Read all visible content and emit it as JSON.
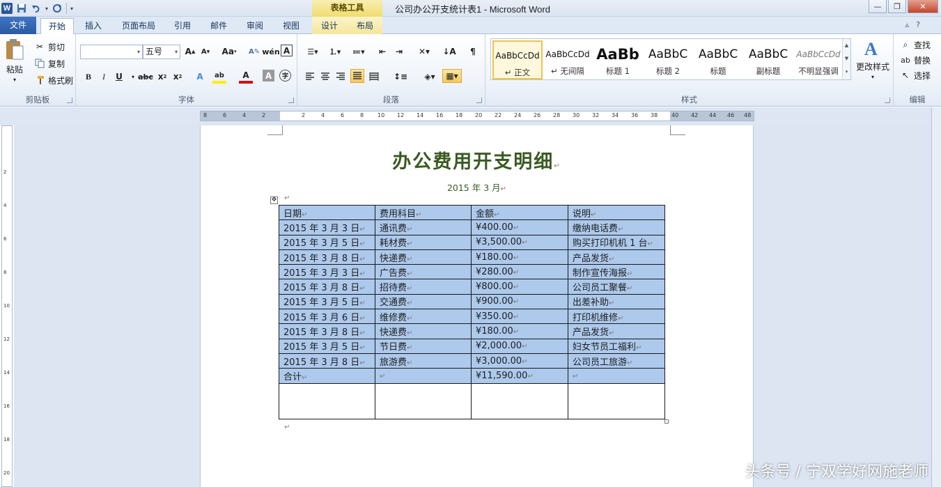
{
  "window": {
    "title": "公司办公开支统计表1 - Microsoft Word",
    "context_tools": "表格工具"
  },
  "qat": {
    "icons": [
      "word-logo-icon",
      "save-icon",
      "undo-icon",
      "redo-icon",
      "customize-qat-icon"
    ]
  },
  "tabs": {
    "file": "文件",
    "items": [
      "开始",
      "插入",
      "页面布局",
      "引用",
      "邮件",
      "审阅",
      "视图",
      "设计",
      "布局"
    ],
    "active_index": 0
  },
  "ribbon": {
    "clipboard": {
      "paste": "粘贴",
      "cut": "剪切",
      "copy": "复制",
      "format_painter": "格式刷",
      "label": "剪贴板"
    },
    "font": {
      "font_name": "",
      "font_size": "五号",
      "label": "字体",
      "change_case": "Aa"
    },
    "paragraph": {
      "label": "段落"
    },
    "styles": {
      "label": "样式",
      "change_styles": "更改样式",
      "items": [
        {
          "sample": "AaBbCcDd",
          "name": "↵ 正文"
        },
        {
          "sample": "AaBbCcDd",
          "name": "↵ 无间隔"
        },
        {
          "sample": "AaBb",
          "name": "标题 1"
        },
        {
          "sample": "AaBbC",
          "name": "标题 2"
        },
        {
          "sample": "AaBbC",
          "name": "标题"
        },
        {
          "sample": "AaBbC",
          "name": "副标题"
        },
        {
          "sample": "AaBbCcDd",
          "name": "不明显强调"
        }
      ]
    },
    "editing": {
      "find": "查找",
      "replace": "替换",
      "select": "选择",
      "label": "编辑"
    }
  },
  "ruler": {
    "ticks": [
      "8",
      "6",
      "4",
      "2",
      "2",
      "4",
      "6",
      "8",
      "10",
      "12",
      "14",
      "16",
      "18",
      "20",
      "22",
      "24",
      "26",
      "28",
      "30",
      "32",
      "34",
      "36",
      "38",
      "40",
      "42",
      "44",
      "46",
      "48"
    ],
    "vticks": [
      "2",
      "4",
      "6",
      "8",
      "10",
      "12",
      "14",
      "16",
      "18",
      "20"
    ]
  },
  "document": {
    "heading": "办公费用开支明细",
    "subheading": "2015 年 3 月",
    "table": {
      "headers": [
        "日期",
        "费用科目",
        "金额",
        "说明"
      ],
      "rows": [
        [
          "2015 年 3 月 3 日",
          "通讯费",
          "¥400.00",
          "缴纳电话费"
        ],
        [
          "2015 年 3 月 5 日",
          "耗材费",
          "¥3,500.00",
          "购买打印机机 1 台"
        ],
        [
          "2015 年 3 月 8 日",
          "快递费",
          "¥180.00",
          "产品发货"
        ],
        [
          "2015 年 3 月 3 日",
          "广告费",
          "¥280.00",
          "制作宣传海报"
        ],
        [
          "2015 年 3 月 8 日",
          "招待费",
          "¥800.00",
          "公司员工聚餐"
        ],
        [
          "2015 年 3 月 5 日",
          "交通费",
          "¥900.00",
          "出差补助"
        ],
        [
          "2015 年 3 月 6 日",
          "维修费",
          "¥350.00",
          "打印机维修"
        ],
        [
          "2015 年 3 月 8 日",
          "快递费",
          "¥180.00",
          "产品发货"
        ],
        [
          "2015 年 3 月 5 日",
          "节日费",
          "¥2,000.00",
          "妇女节员工福利"
        ],
        [
          "2015 年 3 月 8 日",
          "旅游费",
          "¥3,000.00",
          "公司员工旅游"
        ]
      ],
      "total": [
        "合计",
        "",
        "¥11,590.00",
        ""
      ]
    }
  },
  "watermark": "头条号 / 宁双学好网施老师",
  "colors": {
    "heading": "#3a5a22",
    "selection": "#adc9ec",
    "file_tab": "#2a5aa3",
    "context_tab": "#f0dc6f"
  }
}
